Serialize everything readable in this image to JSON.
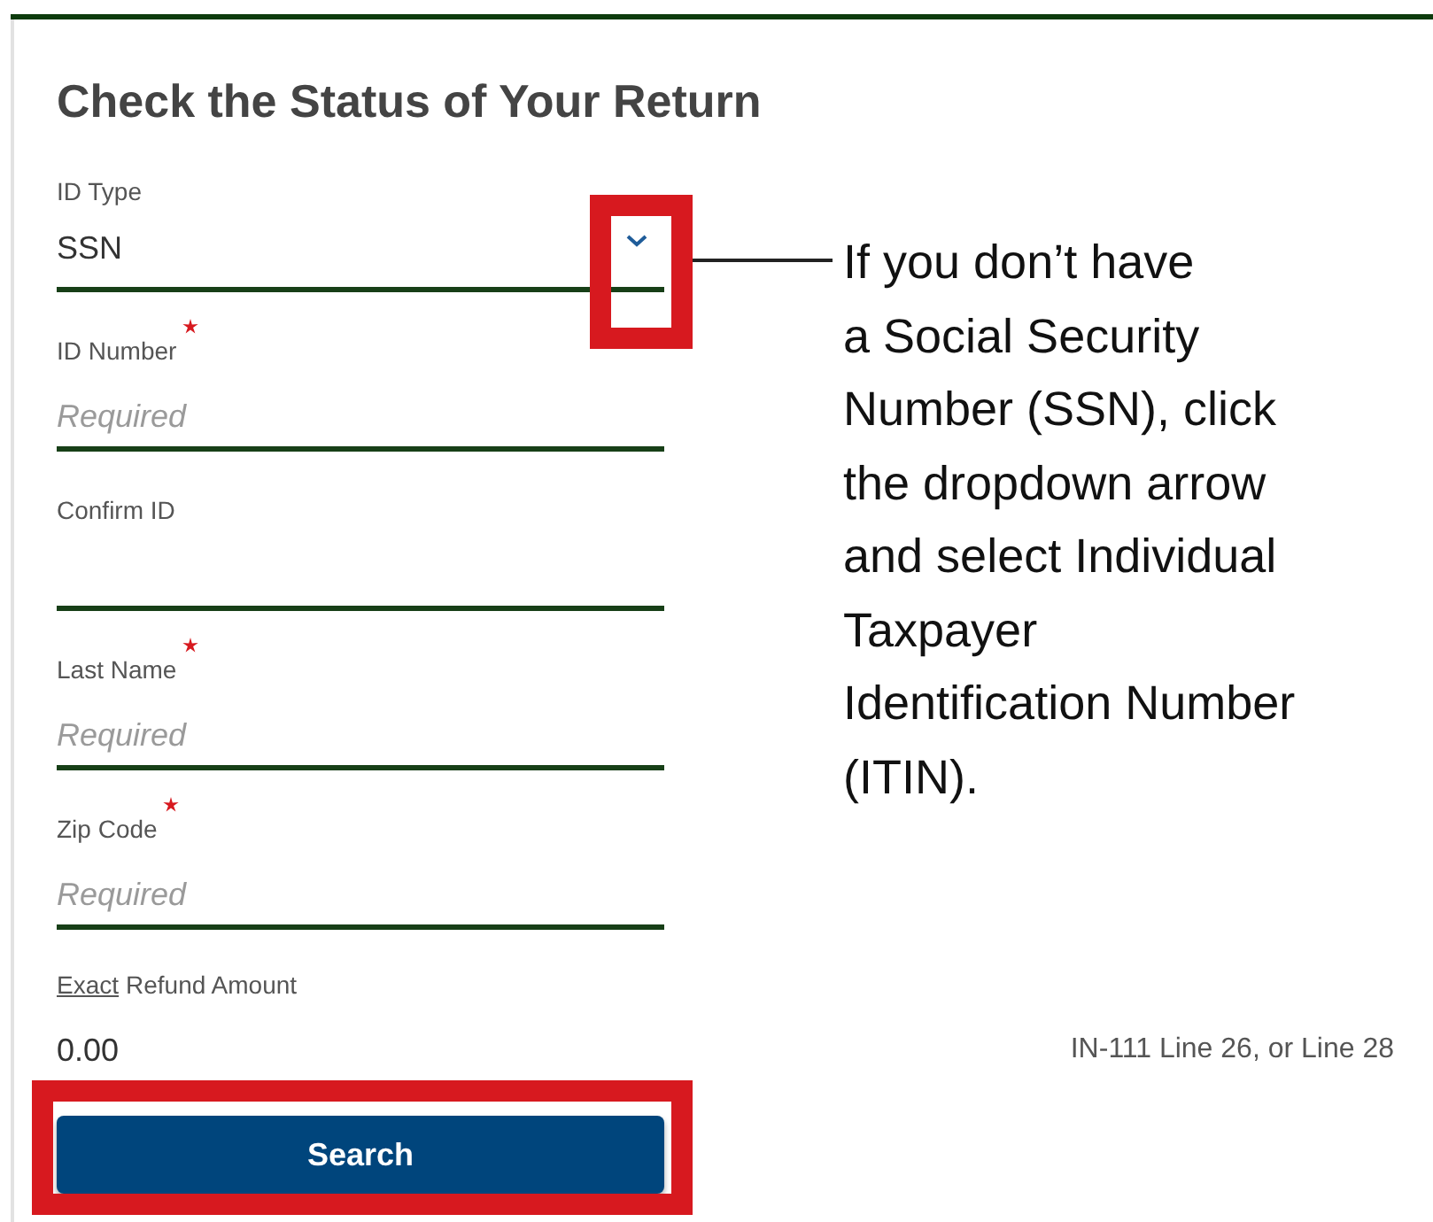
{
  "title": "Check the Status of Your Return",
  "fields": [
    {
      "kind": "select",
      "label": "ID Type",
      "value": "SSN",
      "required": false,
      "highlighted": true
    },
    {
      "kind": "text",
      "label": "ID Number",
      "placeholder": "Required",
      "required": true,
      "highlighted": false
    },
    {
      "kind": "text",
      "label": "Confirm ID",
      "required": false,
      "highlighted": false
    },
    {
      "kind": "text",
      "label": "Last Name",
      "placeholder": "Required",
      "required": true,
      "highlighted": false
    },
    {
      "kind": "text",
      "label": "Zip Code",
      "placeholder": "Required",
      "required": true,
      "highlighted": false
    }
  ],
  "callout": {
    "lines": [
      "If you don’t have",
      "a Social Security",
      "Number (SSN), click",
      "the dropdown arrow",
      "and select Individual",
      "Taxpayer",
      "Identification Number",
      "(ITIN)."
    ]
  },
  "refund": {
    "label_link": "Exact",
    "label_rest": "Refund Amount",
    "value": "0.00",
    "hint": "IN-111 Line 26, or Line 28"
  },
  "search_button": {
    "label": "Search",
    "highlighted": true
  }
}
